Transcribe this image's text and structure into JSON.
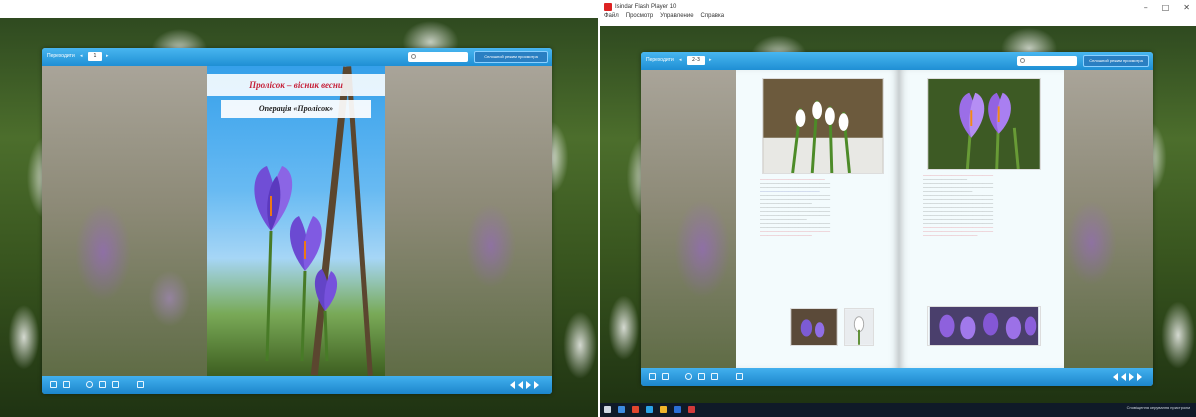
{
  "left_screenshot": {
    "viewer": {
      "page_label": "Переходити",
      "page_value": "1",
      "fullscreen_button": "Сплошной режим просмотра"
    },
    "cover": {
      "title": "Пролісок – вісник весни",
      "subtitle": "Операція «Пролісок»"
    }
  },
  "right_screenshot": {
    "window_title": "Isindar Flash Player 10",
    "menu": [
      "Файл",
      "Просмотр",
      "Управление",
      "Справка"
    ],
    "window_controls": [
      "–",
      "□",
      "✕"
    ],
    "viewer": {
      "page_label": "Переходити",
      "page_value": "2-3",
      "fullscreen_button": "Сплошной режим просмотра"
    },
    "tray_text": "Сповіщення керування пристроєм"
  },
  "colors": {
    "toolbar": "#1f8fd4",
    "toolbar_light": "#48b6f0",
    "cover_title": "#c0233a",
    "text_red": "#d02030",
    "page_bg": "#f3fbfd",
    "taskbar": "#0f1a28"
  },
  "icons": {
    "toolbar_left": [
      "thumbnails-icon",
      "grid-icon",
      "zoom-icon",
      "print-icon",
      "share-icon",
      "sound-icon"
    ],
    "toolbar_right": [
      "first-page-icon",
      "prev-page-icon",
      "next-page-icon",
      "last-page-icon"
    ]
  }
}
